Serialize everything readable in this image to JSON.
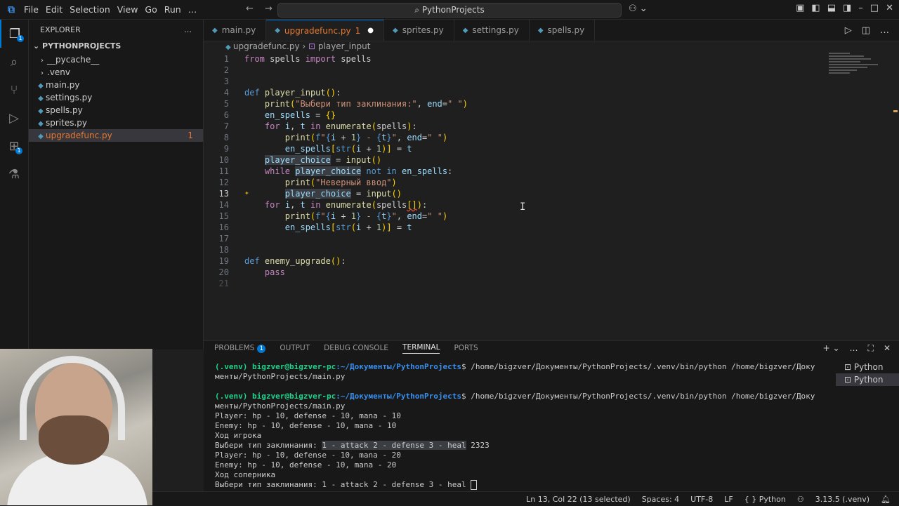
{
  "titlebar": {
    "menu": [
      "File",
      "Edit",
      "Selection",
      "View",
      "Go",
      "Run",
      "…"
    ],
    "search": "PythonProjects"
  },
  "sidebar": {
    "header": "EXPLORER",
    "project": "PYTHONPROJECTS",
    "items": [
      {
        "label": "__pycache__",
        "type": "folder"
      },
      {
        "label": ".venv",
        "type": "folder"
      },
      {
        "label": "main.py",
        "type": "file"
      },
      {
        "label": "settings.py",
        "type": "file"
      },
      {
        "label": "spells.py",
        "type": "file"
      },
      {
        "label": "sprites.py",
        "type": "file"
      },
      {
        "label": "upgradefunc.py",
        "type": "file",
        "count": "1",
        "selected": true
      }
    ]
  },
  "tabs": [
    {
      "label": "main.py"
    },
    {
      "label": "upgradefunc.py",
      "modified": "1",
      "active": true
    },
    {
      "label": "sprites.py"
    },
    {
      "label": "settings.py"
    },
    {
      "label": "spells.py"
    }
  ],
  "breadcrumb": {
    "file": "upgradefunc.py",
    "symbol": "player_input"
  },
  "editor": {
    "line_numbers": [
      "1",
      "2",
      "3",
      "4",
      "5",
      "6",
      "7",
      "8",
      "9",
      "10",
      "11",
      "12",
      "13",
      "14",
      "15",
      "16",
      "17",
      "18",
      "19",
      "20",
      "21"
    ],
    "current_line": "13"
  },
  "panel": {
    "tabs": [
      "PROBLEMS",
      "OUTPUT",
      "DEBUG CONSOLE",
      "TERMINAL",
      "PORTS"
    ],
    "problems_count": "1",
    "sessions": [
      "Python",
      "Python"
    ],
    "terminal": {
      "prompt_user": "(.venv) bigzver@bigzver-pc",
      "prompt_path": ":~/Документы/PythonProjects",
      "cmd1": "$ /home/bigzver/Документы/PythonProjects/.venv/bin/python /home/bigzver/Доку",
      "cmd1_cont": "менты/PythonProjects/main.py",
      "cmd2": "$ /home/bigzver/Документы/PythonProjects/.venv/bin/python /home/bigzver/Доку",
      "cmd2_cont": "менты/PythonProjects/main.py",
      "out1": "Player: hp - 10, defense - 10, mana - 10",
      "out2": "Enemy: hp - 10, defense - 10, mana - 10",
      "out3": "Ход игрока",
      "out4_prefix": "Выбери тип заклинания: ",
      "out4_sel": "1 - attack 2 - defense 3 - heal",
      "out4_suffix": " 2323",
      "out5": "Player: hp - 10, defense - 10, mana - 20",
      "out6": "Enemy: hp - 10, defense - 10, mana - 20",
      "out7": "Ход соперника",
      "out8": "Выбери тип заклинания: 1 - attack 2 - defense 3 - heal "
    }
  },
  "statusbar": {
    "position": "Ln 13, Col 22 (13 selected)",
    "spaces": "Spaces: 4",
    "encoding": "UTF-8",
    "eol": "LF",
    "language": "{ } Python",
    "interpreter": "3.13.5 (.venv)"
  }
}
